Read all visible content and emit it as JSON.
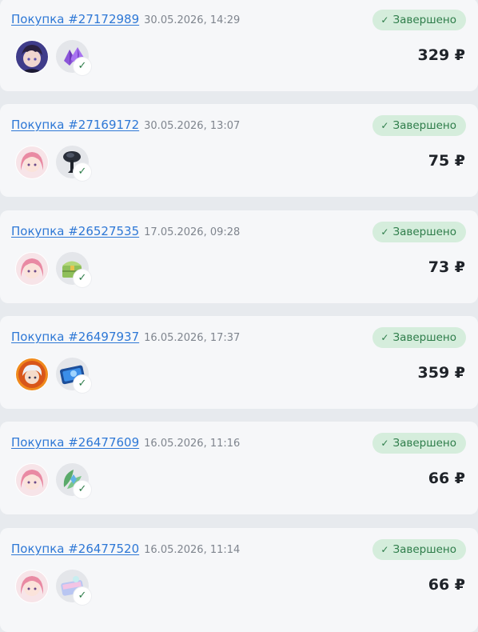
{
  "colors": {
    "link": "#2e78d6",
    "status_bg": "#d5eddc",
    "status_text": "#2e7d4a",
    "card_bg": "#f6f7f9",
    "page_bg": "#e7eaee"
  },
  "purchases": [
    {
      "order_label": "Покупка #27172989",
      "date": "30.05.2026, 14:29",
      "status": "Завершено",
      "price": "329 ₽",
      "game_icon": "anime-boy-avatar-icon",
      "item_icon": "purple-crystals-icon"
    },
    {
      "order_label": "Покупка #27169172",
      "date": "30.05.2026, 13:07",
      "status": "Завершено",
      "price": "75 ₽",
      "game_icon": "pink-hair-girl-avatar-icon",
      "item_icon": "dark-crystal-tree-icon"
    },
    {
      "order_label": "Покупка #26527535",
      "date": "17.05.2026, 09:28",
      "status": "Завершено",
      "price": "73 ₽",
      "game_icon": "pink-hair-girl-avatar-icon",
      "item_icon": "green-treasure-chest-icon"
    },
    {
      "order_label": "Покупка #26497937",
      "date": "16.05.2026, 17:37",
      "status": "Завершено",
      "price": "359 ₽",
      "game_icon": "white-hair-hero-avatar-icon",
      "item_icon": "blue-pass-card-icon"
    },
    {
      "order_label": "Покупка #26477609",
      "date": "16.05.2026, 11:16",
      "status": "Завершено",
      "price": "66 ₽",
      "game_icon": "pink-hair-girl-avatar-icon",
      "item_icon": "green-leaf-crystal-icon"
    },
    {
      "order_label": "Покупка #26477520",
      "date": "16.05.2026, 11:14",
      "status": "Завершено",
      "price": "66 ₽",
      "game_icon": "pink-hair-girl-avatar-icon",
      "item_icon": "pastel-gift-pack-icon"
    }
  ]
}
